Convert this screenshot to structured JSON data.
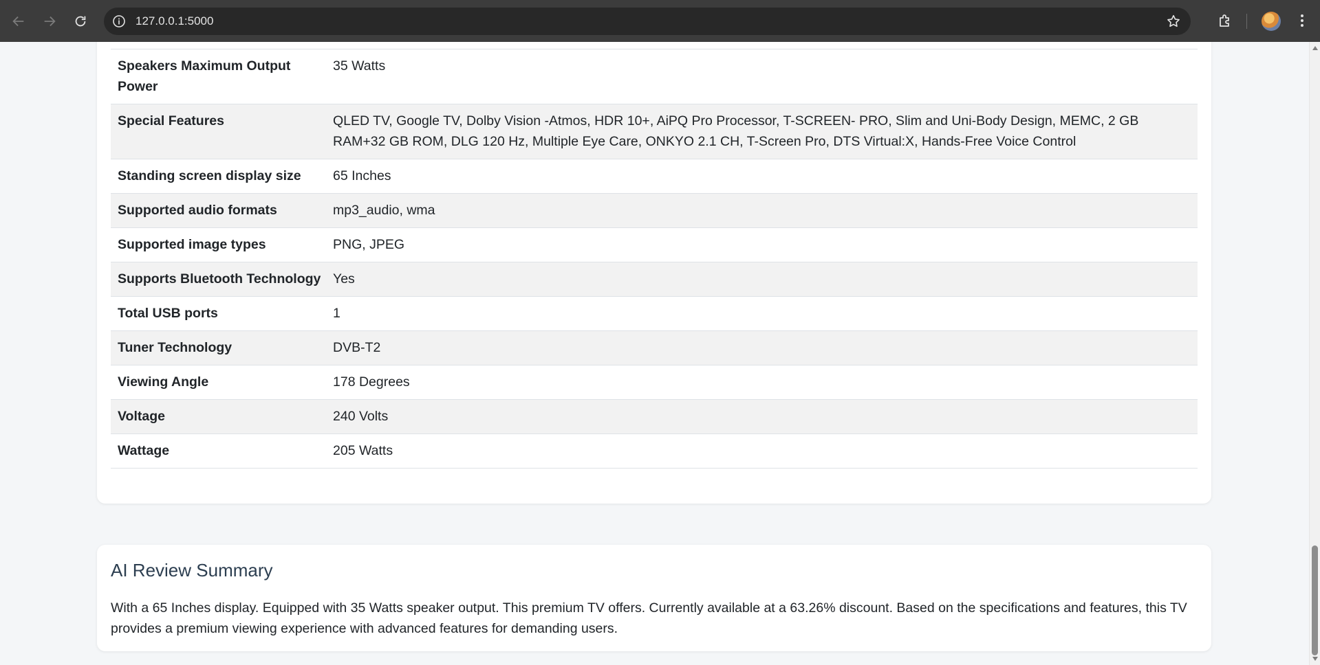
{
  "browser": {
    "url": "127.0.0.1:5000",
    "icons": [
      "back-icon",
      "forward-icon",
      "reload-icon",
      "site-info-icon",
      "bookmark-star-icon",
      "extensions-icon",
      "profile-avatar",
      "menu-icon"
    ]
  },
  "specs": [
    {
      "label": "Speakers Maximum Output Power",
      "value": "35 Watts"
    },
    {
      "label": "Special Features",
      "value": "QLED TV, Google TV, Dolby Vision -Atmos, HDR 10+, AiPQ Pro Processor, T-SCREEN- PRO, Slim and Uni-Body Design, MEMC, 2 GB RAM+32 GB ROM, DLG 120 Hz, Multiple Eye Care, ONKYO 2.1 CH, T-Screen Pro, DTS Virtual:X, Hands-Free Voice Control"
    },
    {
      "label": "Standing screen display size",
      "value": "65 Inches"
    },
    {
      "label": "Supported audio formats",
      "value": "mp3_audio, wma"
    },
    {
      "label": "Supported image types",
      "value": "PNG, JPEG"
    },
    {
      "label": "Supports Bluetooth Technology",
      "value": "Yes"
    },
    {
      "label": "Total USB ports",
      "value": "1"
    },
    {
      "label": "Tuner Technology",
      "value": "DVB-T2"
    },
    {
      "label": "Viewing Angle",
      "value": "178 Degrees"
    },
    {
      "label": "Voltage",
      "value": "240 Volts"
    },
    {
      "label": "Wattage",
      "value": "205 Watts"
    }
  ],
  "review": {
    "title": "AI Review Summary",
    "text": "With a 65 Inches display. Equipped with 35 Watts speaker output. This premium TV offers. Currently available at a 63.26% discount. Based on the specifications and features, this TV provides a premium viewing experience with advanced features for demanding users."
  },
  "colors": {
    "chrome_bg": "#3c3c3c",
    "omnibox_bg": "#282828",
    "page_bg": "#f4f6f8",
    "stripe_bg": "#f2f2f2",
    "heading": "#2c3e50"
  }
}
